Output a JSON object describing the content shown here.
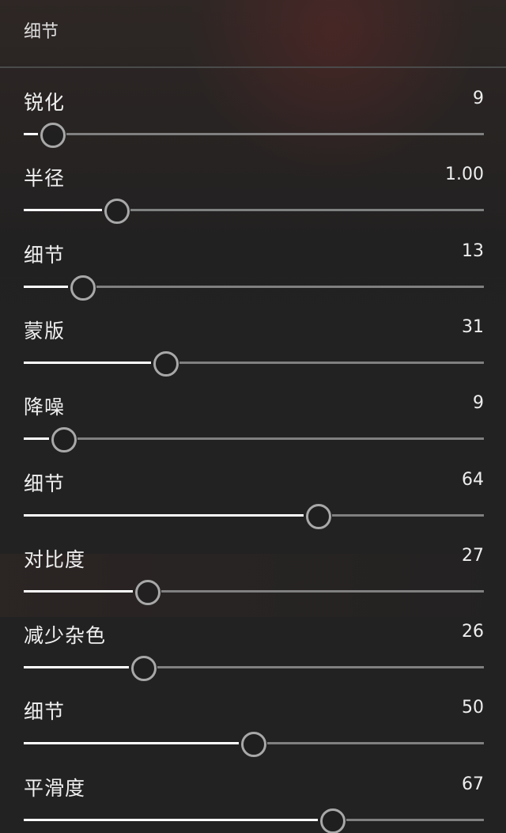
{
  "section": {
    "title": "细节"
  },
  "sliders": [
    {
      "label": "锐化",
      "value": "9",
      "level": 0.062
    },
    {
      "label": "半径",
      "value": "1.00",
      "level": 0.201
    },
    {
      "label": "细节",
      "value": "13",
      "level": 0.127
    },
    {
      "label": "蒙版",
      "value": "31",
      "level": 0.308
    },
    {
      "label": "降噪",
      "value": "9",
      "level": 0.086
    },
    {
      "label": "细节",
      "value": "64",
      "level": 0.64
    },
    {
      "label": "对比度",
      "value": "27",
      "level": 0.268
    },
    {
      "label": "减少杂色",
      "value": "26",
      "level": 0.259
    },
    {
      "label": "细节",
      "value": "50",
      "level": 0.498
    },
    {
      "label": "平滑度",
      "value": "67",
      "level": 0.67
    }
  ],
  "colors": {
    "background": "#222222",
    "track_fill": "#ffffff",
    "track_rest": "#808080",
    "thumb_border": "#a8a8a8"
  }
}
